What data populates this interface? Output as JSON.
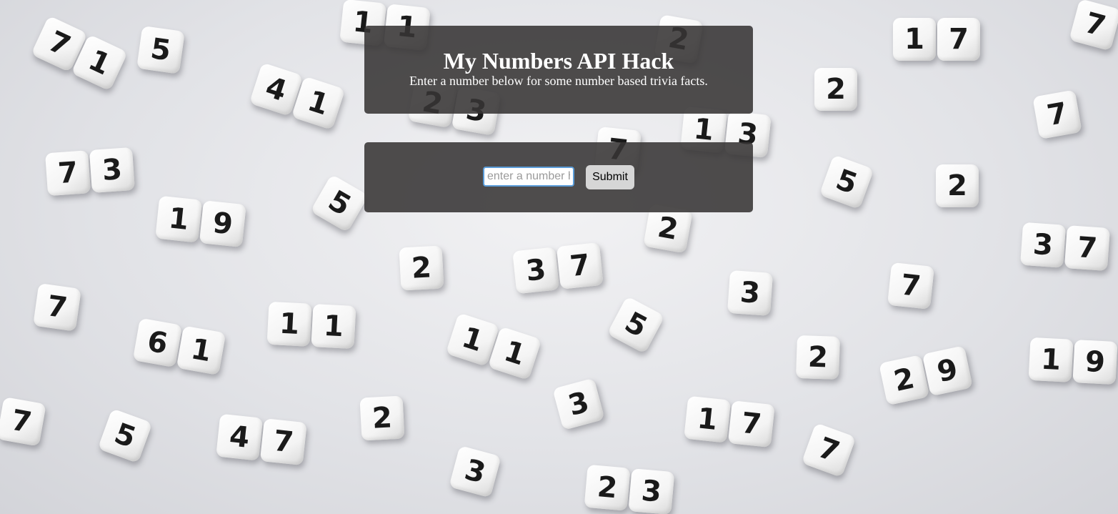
{
  "header": {
    "title": "My Numbers API Hack",
    "subtitle": "Enter a number below for some number based trivia facts."
  },
  "form": {
    "input_placeholder": "enter a number here",
    "input_value": "",
    "submit_label": "Submit"
  },
  "background": {
    "description_icon": "number-dice-beads-photo",
    "beads": [
      "11",
      "5",
      "71",
      "41",
      "23",
      "73",
      "19",
      "5",
      "2",
      "37",
      "7",
      "11",
      "61",
      "11",
      "5",
      "3",
      "7",
      "5",
      "47",
      "2",
      "3",
      "23",
      "3",
      "2",
      "29",
      "17",
      "7",
      "5",
      "2",
      "17",
      "2",
      "7",
      "13",
      "7",
      "2",
      "37",
      "7",
      "19",
      "7",
      "2"
    ],
    "colors": {
      "surface": "#e6e6ea",
      "bead": "#ffffff",
      "digit": "#1a1a1a"
    }
  },
  "colors": {
    "panel": "rgba(55,52,52,0.88)",
    "panel_text": "#ffffff",
    "input_focus_border": "#5b9dd9",
    "button_bg": "#d6d6d6"
  }
}
